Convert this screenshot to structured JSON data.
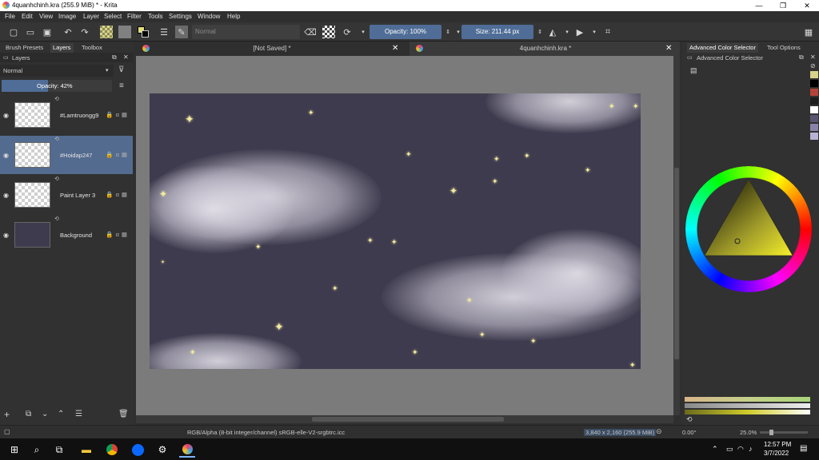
{
  "window": {
    "title": "4quanhchinh.kra (255.9 MiB)  * - Krita",
    "minimize": "—",
    "maximize": "❐",
    "close": "✕"
  },
  "menu": [
    "File",
    "Edit",
    "View",
    "Image",
    "Layer",
    "Select",
    "Filter",
    "Tools",
    "Settings",
    "Window",
    "Help"
  ],
  "toolbar": {
    "blend_mode": "Normal",
    "opacity": "Opacity: 100%",
    "size": "Size: 211.44 px"
  },
  "left_dock": {
    "tabs": [
      "Brush Presets",
      "Layers",
      "Toolbox"
    ],
    "panel_title": "Layers",
    "blend_mode": "Normal",
    "opacity": "Opacity:  42%",
    "layers": [
      {
        "name": "#Lamtruongg9",
        "selected": false
      },
      {
        "name": "#Hoidap247",
        "selected": true
      },
      {
        "name": "Paint Layer 3",
        "selected": false
      },
      {
        "name": "Background",
        "selected": false
      }
    ]
  },
  "doc_tabs": [
    "[Not Saved]  *",
    "4quanhchinh.kra  *"
  ],
  "right_dock": {
    "tabs": [
      "Advanced Color Selector",
      "Tool Options"
    ],
    "panel_title": "Advanced Color Selector",
    "swatches": [
      "#d7d48a",
      "#000000",
      "#b3443a",
      "#1e1e1e",
      "#ffffff",
      "#5a5470",
      "#8a82a8",
      "#b8b2d4"
    ]
  },
  "status": {
    "color_info": "RGB/Alpha (8-bit integer/channel)  sRGB-elle-V2-srgbtrc.icc",
    "dimensions": "3,840 x 2,160 (255.9 MiB)",
    "rotation": "0.00°",
    "zoom": "25.0%"
  },
  "taskbar": {
    "time": "12:57 PM",
    "date": "3/7/2022"
  }
}
